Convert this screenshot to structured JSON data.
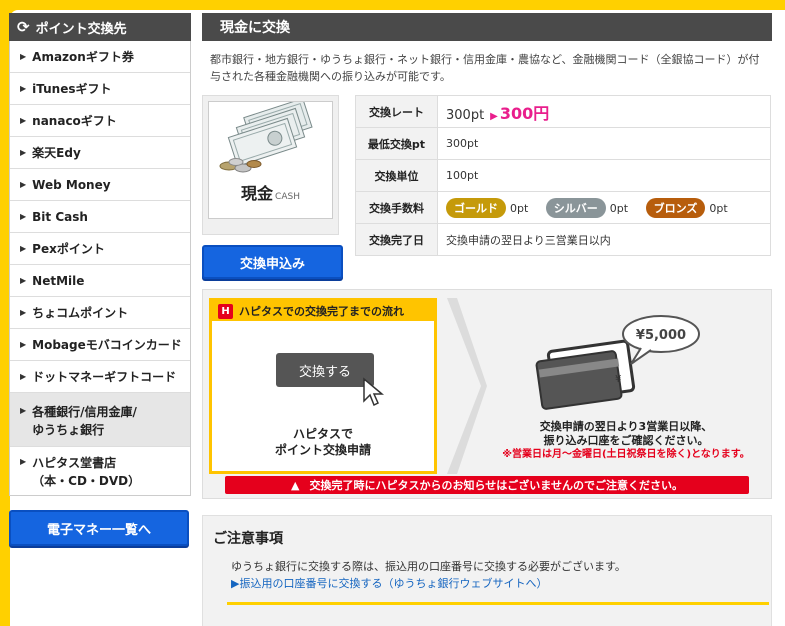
{
  "sidebar": {
    "title": "ポイント交換先",
    "items": [
      {
        "label": "Amazonギフト券"
      },
      {
        "label": "iTunesギフト"
      },
      {
        "label": "nanacoギフト"
      },
      {
        "label": "楽天Edy"
      },
      {
        "label": "Web Money"
      },
      {
        "label": "Bit Cash"
      },
      {
        "label": "Pexポイント"
      },
      {
        "label": "NetMile"
      },
      {
        "label": "ちょコムポイント"
      },
      {
        "label": "Mobageモバコインカード"
      },
      {
        "label": "ドットマネーギフトコード"
      },
      {
        "label": "各種銀行/信用金庫/\nゆうちょ銀行"
      },
      {
        "label": "ハピタス堂書店\n（本・CD・DVD）"
      }
    ],
    "emoney_button": "電子マネー一覧へ"
  },
  "main": {
    "title": "現金に交換",
    "intro": "都市銀行・地方銀行・ゆうちょ銀行・ネット銀行・信用金庫・農協など、金融機関コード（全銀協コード）が付与された各種金融機関への振り込みが可能です。",
    "cash_label": "現金",
    "cash_sub": "CASH",
    "apply_button": "交換申込み",
    "table": {
      "rate_key": "交換レート",
      "rate_from": "300pt",
      "rate_to": "300円",
      "min_key": "最低交換pt",
      "min_val": "300pt",
      "unit_key": "交換単位",
      "unit_val": "100pt",
      "fee_key": "交換手数料",
      "fee_gold": "ゴールド",
      "fee_gold_val": "0pt",
      "fee_silver": "シルバー",
      "fee_silver_val": "0pt",
      "fee_bronze": "ブロンズ",
      "fee_bronze_val": "0pt",
      "done_key": "交換完了日",
      "done_val": "交換申請の翌日より三営業日以内"
    }
  },
  "flow": {
    "logo": "H",
    "title": "ハピタスでの交換完了までの流れ",
    "fake_button": "交換する",
    "caption_line1": "ハピタスで",
    "caption_line2": "ポイント交換申請",
    "amount": "¥5,000",
    "right_line1": "交換申請の翌日より3営業日以降、",
    "right_line2": "振り込み口座をご確認ください。",
    "right_note": "※営業日は月～金曜日(土日祝祭日を除く)となります。",
    "warning": "交換完了時にハピタスからのお知らせはございませんのでご注意ください。"
  },
  "notes": {
    "title": "ご注意事項",
    "text": "ゆうちょ銀行に交換する際は、振込用の口座番号に交換する必要がございます。",
    "link": "▶振込用の口座番号に交換する（ゆうちょ銀行ウェブサイトへ）"
  },
  "colors": {
    "background": "#ffd000",
    "header": "#4a4a4a",
    "button": "#1565e0",
    "accent_pink": "#e91e8c",
    "warn_red": "#e5001c"
  }
}
